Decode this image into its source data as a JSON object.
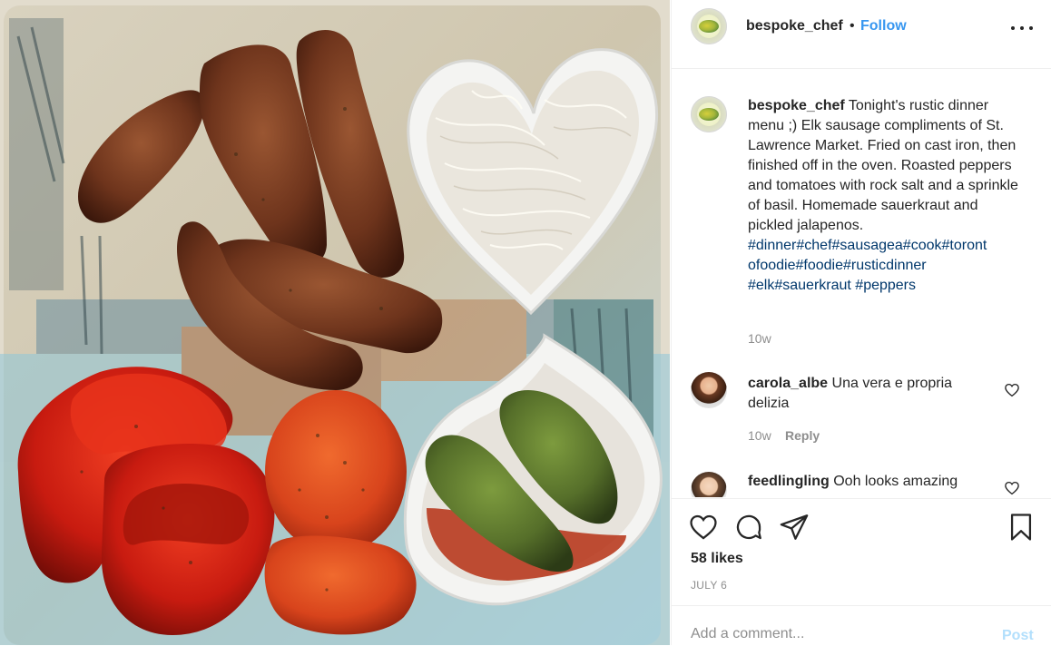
{
  "post": {
    "image_alt": "Plate with elk sausages, roasted peppers and tomatoes, sauerkraut and pickled jalapenos"
  },
  "header": {
    "username": "bespoke_chef",
    "separator": "•",
    "follow_label": "Follow",
    "more_icon": "more-dots-icon"
  },
  "caption": {
    "username": "bespoke_chef",
    "text": "Tonight's rustic dinner menu ;) Elk sausage compliments of St. Lawrence Market. Fried on cast iron, then finished off in the oven. Roasted peppers and tomatoes with rock salt and a sprinkle of basil. Homemade sauerkraut and pickled jalapenos.",
    "hashtags_line1": "#dinner#chef#sausagea#cook#toront",
    "hashtags_line2": "ofoodie#foodie#rusticdinner",
    "hashtags_line3": "#elk#sauerkraut #peppers",
    "time": "10w"
  },
  "comments": [
    {
      "username": "carola_albe",
      "text": "Una vera e propria delizia",
      "time": "10w",
      "reply_label": "Reply"
    },
    {
      "username": "feedlingling",
      "text": "Ooh looks amazing"
    }
  ],
  "actions": {
    "like_icon": "heart-icon",
    "comment_icon": "comment-bubble-icon",
    "share_icon": "paper-plane-icon",
    "save_icon": "bookmark-icon",
    "likes": "58 likes",
    "date": "JULY 6"
  },
  "add_comment": {
    "placeholder": "Add a comment...",
    "post_label": "Post"
  },
  "colors": {
    "link": "#3897f0",
    "hashtag": "#00376b",
    "muted": "#8e8e8e",
    "post_disabled": "#b2dffc"
  }
}
